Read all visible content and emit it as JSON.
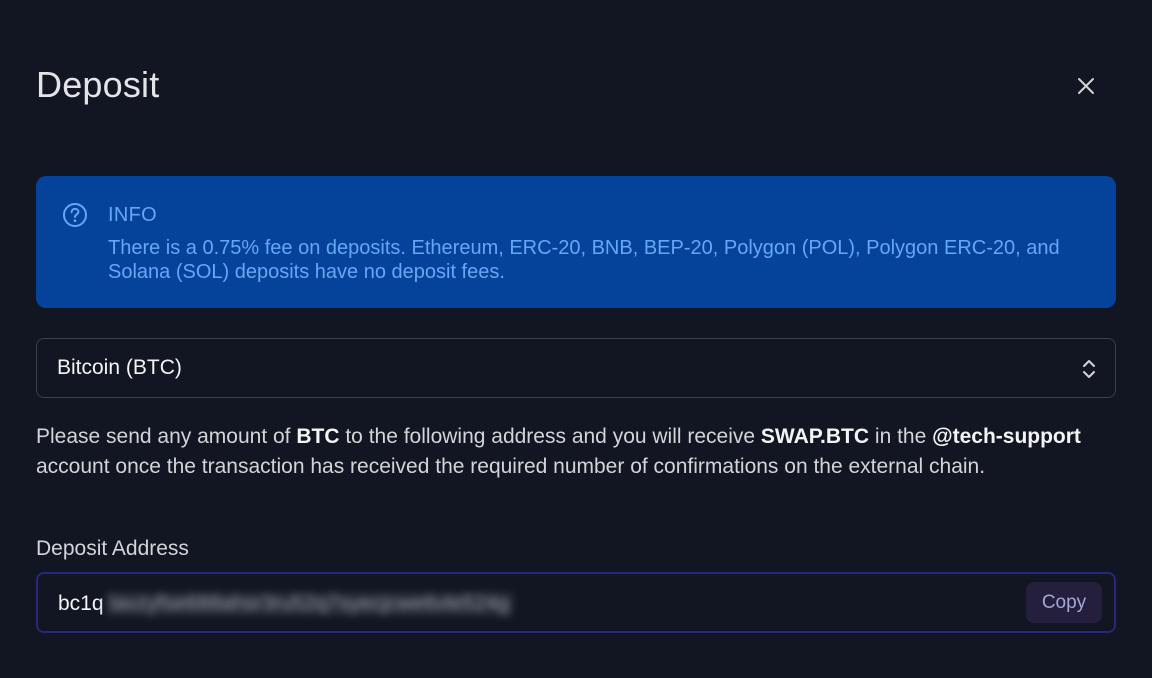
{
  "modal": {
    "title": "Deposit",
    "close_icon": "close-icon"
  },
  "info": {
    "icon": "question-circle-icon",
    "heading": "INFO",
    "text": "There is a 0.75% fee on deposits. Ethereum, ERC-20, BNB, BEP-20, Polygon (POL), Polygon ERC-20, and Solana (SOL) deposits have no deposit fees.",
    "colors": {
      "background": "#05439a",
      "text": "#63a8f5"
    }
  },
  "asset_select": {
    "selected": "Bitcoin (BTC)",
    "icon": "chevron-up-down-icon"
  },
  "instructions": {
    "part1": "Please send any amount of ",
    "asset": "BTC",
    "part2": " to the following address and you will receive ",
    "token": "SWAP.BTC",
    "part3": " in the ",
    "account": "@tech-support",
    "part4": " account once the transaction has received the required number of confirmations on the external chain."
  },
  "deposit_address": {
    "label": "Deposit Address",
    "prefix": "bc1q",
    "hidden_value": "lavzyfse688ahsr3ru52q7syecjcwe6vle524g",
    "copy_label": "Copy"
  },
  "colors": {
    "page_background": "#111622",
    "field_border_focus": "#23287a",
    "copy_button_background": "#231f3d"
  }
}
